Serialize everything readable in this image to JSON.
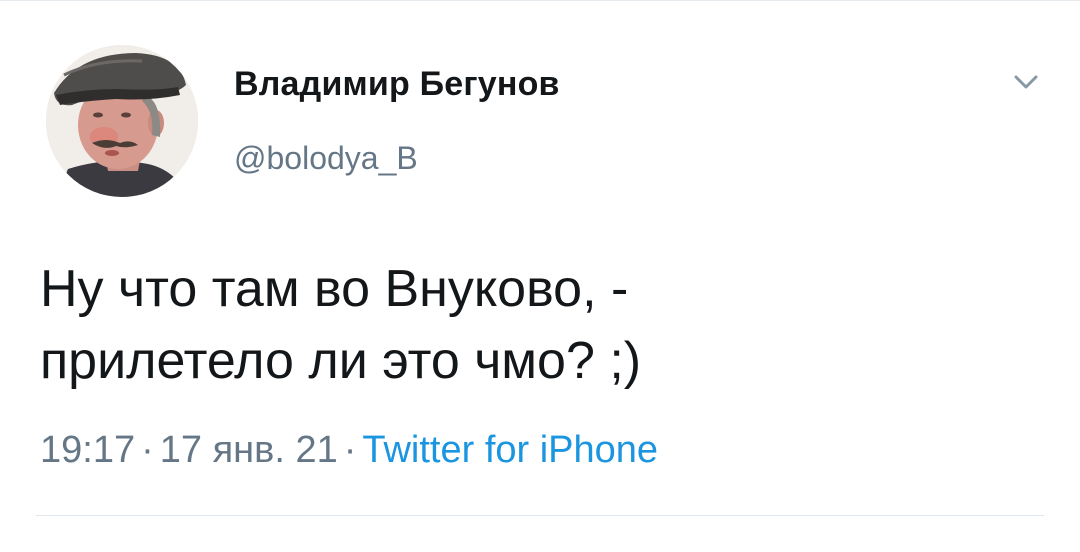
{
  "tweet": {
    "author": {
      "display_name": "Владимир Бегунов",
      "handle": "@bolodya_B"
    },
    "text_lines": [
      "Ну что там во Внуково, -",
      "прилетело ли это чмо? ;)"
    ],
    "meta": {
      "time": "19:17",
      "separator": "·",
      "date": "17 янв. 21",
      "source": "Twitter for iPhone"
    },
    "icons": {
      "menu": "chevron-down-icon"
    },
    "colors": {
      "text": "#14171a",
      "secondary": "#657786",
      "link": "#1b95e0"
    }
  }
}
